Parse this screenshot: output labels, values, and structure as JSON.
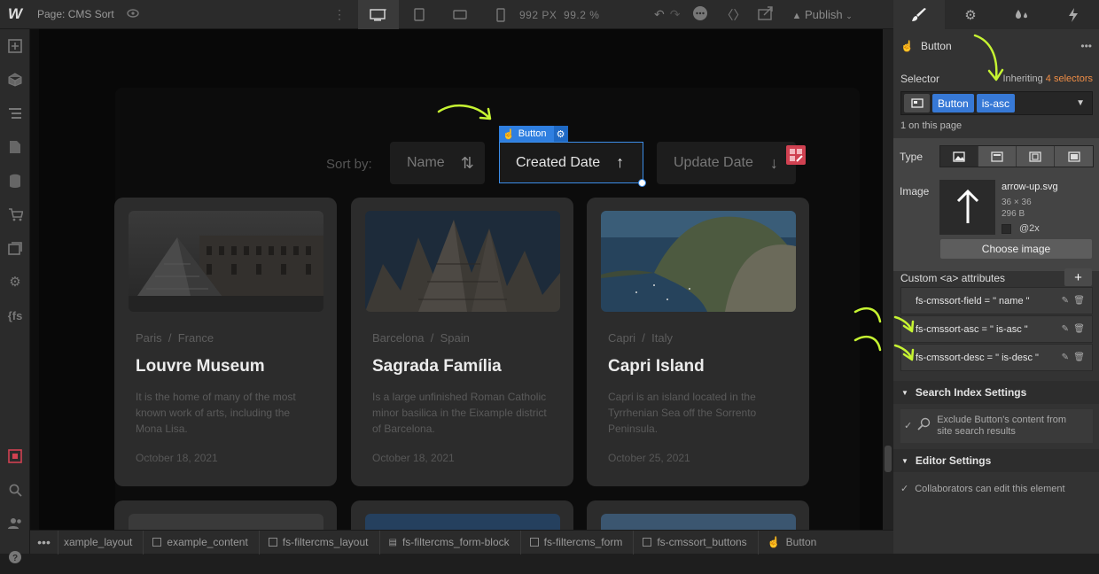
{
  "topbar": {
    "logo": "W",
    "page_label": "Page: CMS Sort",
    "width_px": "992 PX",
    "zoom": "99.2 %",
    "publish": "Publish"
  },
  "canvas": {
    "sort_by": "Sort by:",
    "element_tag": "Button",
    "buttons": [
      {
        "label": "Name",
        "arrow": "⇅"
      },
      {
        "label": "Created Date",
        "arrow": "↑"
      },
      {
        "label": "Update Date",
        "arrow": "↓"
      }
    ],
    "cards": [
      {
        "city": "Paris",
        "country": "France",
        "title": "Louvre Museum",
        "desc": "It is the home of many of the most known work of arts, including the Mona Lisa.",
        "date": "October 18, 2021"
      },
      {
        "city": "Barcelona",
        "country": "Spain",
        "title": "Sagrada Família",
        "desc": "Is a large unfinished Roman Catholic minor basilica in the Eixample district of Barcelona.",
        "date": "October 18, 2021"
      },
      {
        "city": "Capri",
        "country": "Italy",
        "title": "Capri Island",
        "desc": "Capri is an island located in the Tyrrhenian Sea off the Sorrento Peninsula.",
        "date": "October 25, 2021"
      }
    ]
  },
  "breadcrumbs": [
    "xample_layout",
    "example_content",
    "fs-filtercms_layout",
    "fs-filtercms_form-block",
    "fs-filtercms_form",
    "fs-cmssort_buttons",
    "Button"
  ],
  "right_panel": {
    "element": "Button",
    "selector_label": "Selector",
    "inheriting_prefix": "Inheriting",
    "inheriting_count": "4 selectors",
    "chips": [
      "Button",
      "is-asc"
    ],
    "on_page": "1 on this page",
    "type_label": "Type",
    "image_label": "Image",
    "file_name": "arrow-up.svg",
    "file_dim": "36 × 36",
    "file_size": "296 B",
    "retina": "@2x",
    "choose_image": "Choose image",
    "custom_attrs_label": "Custom <a> attributes",
    "attributes": [
      "fs-cmssort-field = \" name \"",
      "fs-cmssort-asc = \" is-asc \"",
      "fs-cmssort-desc = \" is-desc \""
    ],
    "search_section": "Search Index Settings",
    "exclude_text": "Exclude Button's content from site search results",
    "editor_section": "Editor Settings",
    "collab_text": "Collaborators can edit this element"
  },
  "accent_colors": {
    "selection": "#3c8de8",
    "chip": "#3779d6",
    "inherit": "#f08e46",
    "annotation": "#c6f432"
  }
}
